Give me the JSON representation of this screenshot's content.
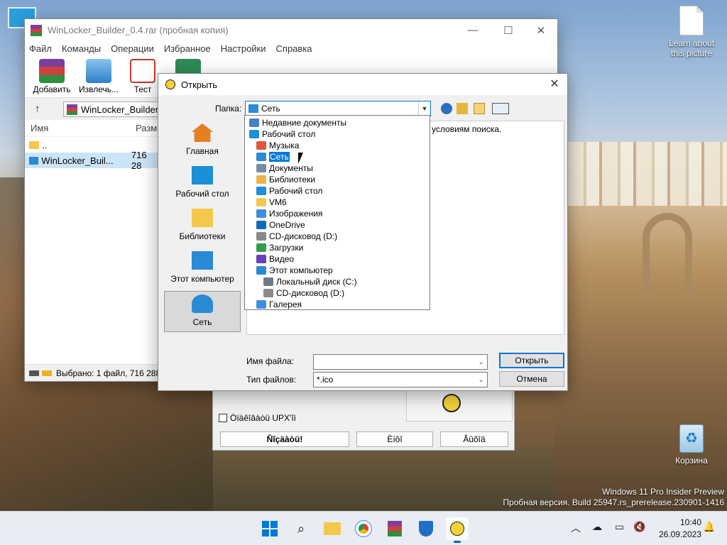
{
  "desktop": {
    "icons": [
      {
        "label": "Learn about this picture"
      },
      {
        "label": "Корзина"
      }
    ],
    "watermark": {
      "line1": "Windows 11 Pro Insider Preview",
      "line2": "Пробная версия. Build 25947.rs_prerelease.230901-1416"
    }
  },
  "winrar": {
    "title": "WinLocker_Builder_0.4.rar (пробная копия)",
    "menu": [
      "Файл",
      "Команды",
      "Операции",
      "Избранное",
      "Настройки",
      "Справка"
    ],
    "toolbar": [
      "Добавить",
      "Извлечь...",
      "Тест"
    ],
    "path": "WinLocker_Builder_0",
    "columns": {
      "name": "Имя",
      "size": "Разме"
    },
    "rows": [
      {
        "name": "..",
        "size": ""
      },
      {
        "name": "WinLocker_Buil...",
        "size": "716 28"
      }
    ],
    "status": "Выбрано: 1 файл, 716 288"
  },
  "builder": {
    "checkbox_label": "Óïàêîâàòü UPX'îì",
    "buttons": [
      "Ñîçäàòü!",
      "Èíôî",
      "Âûõîä"
    ]
  },
  "dialog": {
    "title": "Открыть",
    "folder_label": "Папка:",
    "folder_value": "Сеть",
    "places": [
      "Главная",
      "Рабочий стол",
      "Библиотеки",
      "Этот компьютер",
      "Сеть"
    ],
    "content_text": "их условиям поиска.",
    "filename_label": "Имя файла:",
    "filename_value": "",
    "filetype_label": "Тип файлов:",
    "filetype_value": "*.ico",
    "open_button": "Открыть",
    "cancel_button": "Отмена"
  },
  "dropdown": {
    "items": [
      {
        "label": "Недавние документы",
        "indent": 0,
        "icon": "recent-icon",
        "color": "#4a7fc1"
      },
      {
        "label": "Рабочий стол",
        "indent": 0,
        "icon": "desktop-icon",
        "color": "#1d8fd8"
      },
      {
        "label": "Музыка",
        "indent": 1,
        "icon": "music-icon",
        "color": "#e0573c"
      },
      {
        "label": "Сеть",
        "indent": 1,
        "icon": "network-icon",
        "color": "#2a8ad4",
        "selected": true
      },
      {
        "label": "Документы",
        "indent": 1,
        "icon": "documents-icon",
        "color": "#7a8aa0"
      },
      {
        "label": "Библиотеки",
        "indent": 1,
        "icon": "libraries-icon",
        "color": "#e8b64a"
      },
      {
        "label": "Рабочий стол",
        "indent": 1,
        "icon": "desktop-icon",
        "color": "#1d8fd8"
      },
      {
        "label": "VM6",
        "indent": 1,
        "icon": "folder-icon",
        "color": "#f2c94c"
      },
      {
        "label": "Изображения",
        "indent": 1,
        "icon": "pictures-icon",
        "color": "#3d8ee0"
      },
      {
        "label": "OneDrive",
        "indent": 1,
        "icon": "onedrive-icon",
        "color": "#0f6cbd"
      },
      {
        "label": "CD-дисковод (D:)",
        "indent": 1,
        "icon": "cd-drive-icon",
        "color": "#8a8a8a"
      },
      {
        "label": "Загрузки",
        "indent": 1,
        "icon": "downloads-icon",
        "color": "#2e9e4e"
      },
      {
        "label": "Видео",
        "indent": 1,
        "icon": "video-icon",
        "color": "#6b3fb5"
      },
      {
        "label": "Этот компьютер",
        "indent": 1,
        "icon": "computer-icon",
        "color": "#2a8ad4"
      },
      {
        "label": "Локальный диск (C:)",
        "indent": 2,
        "icon": "disk-icon",
        "color": "#6c7a89"
      },
      {
        "label": "CD-дисковод (D:)",
        "indent": 2,
        "icon": "cd-drive-icon",
        "color": "#8a8a8a"
      },
      {
        "label": "Галерея",
        "indent": 1,
        "icon": "gallery-icon",
        "color": "#3d8ee0"
      }
    ]
  },
  "taskbar": {
    "time": "10:40",
    "date": "26.09.2023",
    "apps": [
      "start-icon",
      "search-icon",
      "explorer-icon",
      "chrome-icon",
      "winrar-icon",
      "defender-icon",
      "builder-icon"
    ]
  }
}
